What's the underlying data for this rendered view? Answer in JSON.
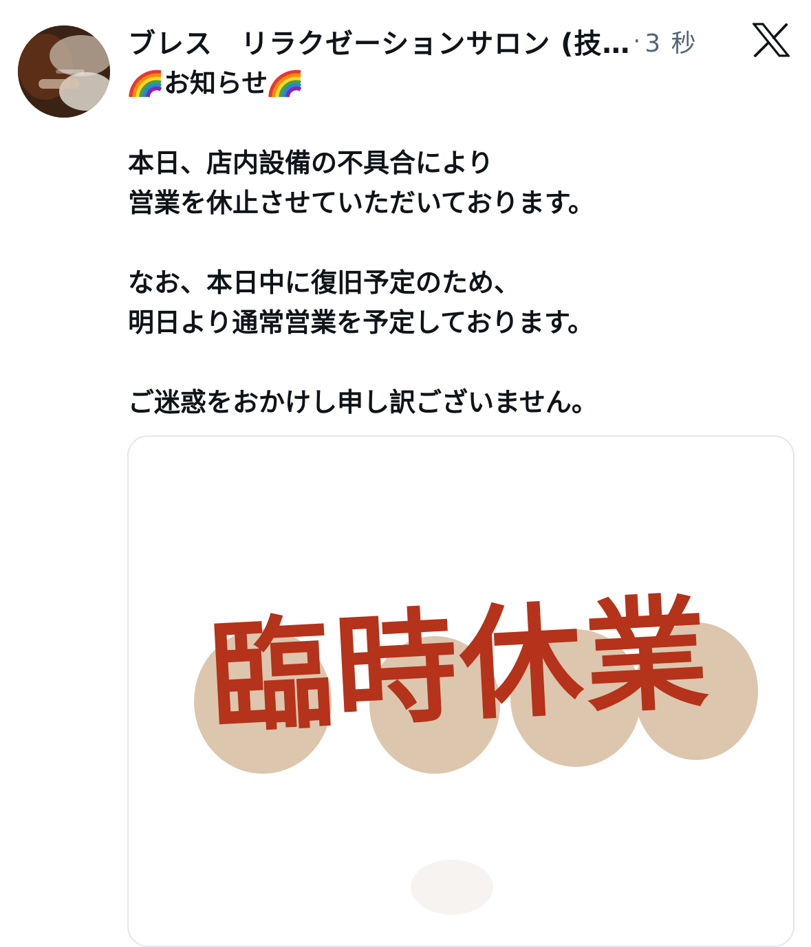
{
  "tweet": {
    "display_name": "ブレス　リラクゼーションサロン (技…",
    "separator": "·",
    "time": "3 秒",
    "brand_icon": "x-logo-icon",
    "heading_icon": "rainbow-emoji-icon",
    "heading": "お知らせ",
    "lines": [
      "本日、店内設備の不具合により",
      "営業を休止させていただいております。",
      "",
      "なお、本日中に復旧予定のため、",
      "明日より通常営業を予定しております。",
      "",
      "ご迷惑をおかけし申し訳ございません。"
    ]
  },
  "media": {
    "text": "臨時休業",
    "text_color": "#b5321b",
    "blob_color": "#dcc6ae"
  }
}
